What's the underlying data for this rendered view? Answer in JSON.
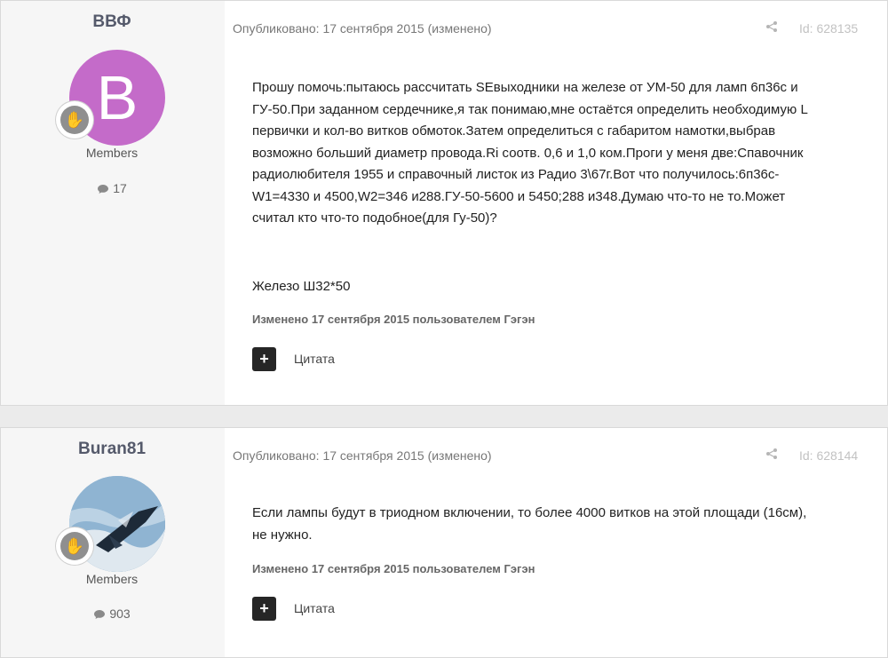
{
  "posts": [
    {
      "author": "ВВФ",
      "avatar_letter": "B",
      "avatar_color": "#c46bc9",
      "role": "Members",
      "post_count": "17",
      "published": "Опубликовано: 17 сентября 2015 (изменено)",
      "id_label": "Id: 628135",
      "content": [
        "Прошу помочь:пытаюсь рассчитать SEвыходники на железе от УМ-50 для ламп 6п36с и",
        "ГУ-50.При заданном сердечнике,я так понимаю,мне остаётся определить необходимую L",
        "первички и кол-во витков обмоток.Затем определиться с габаритом намотки,выбрав",
        "возможно больший диаметр провода.Ri соотв. 0,6 и 1,0 ком.Проги у меня две:Спавочник",
        "радиолюбителя 1955 и справочный листок из Радио 3\\67г.Вот что получилось:6п36с-",
        "W1=4330 и 4500,W2=346 и288.ГУ-50-5600 и 5450;288 и348.Думаю что-то не то.Может",
        "считал кто что-то подобное(для Гу-50)?",
        "",
        "",
        "Железо Ш32*50"
      ],
      "edited": "Изменено 17 сентября 2015 пользователем Гэгэн",
      "quote_label": "Цитата",
      "plus_label": "+"
    },
    {
      "author": "Buran81",
      "role": "Members",
      "post_count": "903",
      "published": "Опубликовано: 17 сентября 2015 (изменено)",
      "id_label": "Id: 628144",
      "content": [
        "Если лампы будут в триодном включении, то более 4000 витков на этой площади (16см),",
        "не нужно."
      ],
      "edited": "Изменено 17 сентября 2015 пользователем Гэгэн",
      "quote_label": "Цитата",
      "plus_label": "+"
    }
  ],
  "icons": {
    "share": "share-icon",
    "comment": "comment-icon",
    "rank": "hand-icon"
  },
  "colors": {
    "accent": "#555a6b",
    "badge": "#8f8f8f",
    "avatar_bg": "#c46bc9"
  }
}
